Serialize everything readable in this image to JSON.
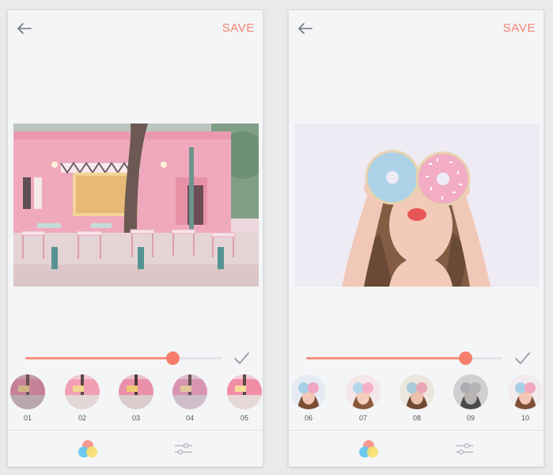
{
  "screens": [
    {
      "top_bar": {
        "back_icon": "arrow-left-icon",
        "save_label": "SAVE"
      },
      "slider": {
        "value": 0.75
      },
      "filters": [
        {
          "label": "01"
        },
        {
          "label": "02"
        },
        {
          "label": "03"
        },
        {
          "label": "04"
        },
        {
          "label": "05"
        }
      ],
      "bottom_tabs": {
        "left_icon": "color-filter-icon",
        "right_icon": "adjust-sliders-icon"
      }
    },
    {
      "top_bar": {
        "back_icon": "arrow-left-icon",
        "save_label": "SAVE"
      },
      "slider": {
        "value": 0.81
      },
      "filters": [
        {
          "label": "06"
        },
        {
          "label": "07"
        },
        {
          "label": "08"
        },
        {
          "label": "09"
        },
        {
          "label": "10"
        }
      ],
      "bottom_tabs": {
        "left_icon": "color-filter-icon",
        "right_icon": "adjust-sliders-icon"
      }
    }
  ],
  "colors": {
    "accent": "#f3836e",
    "slider_fill": "#f5917c",
    "background": "#f4f5f7"
  }
}
